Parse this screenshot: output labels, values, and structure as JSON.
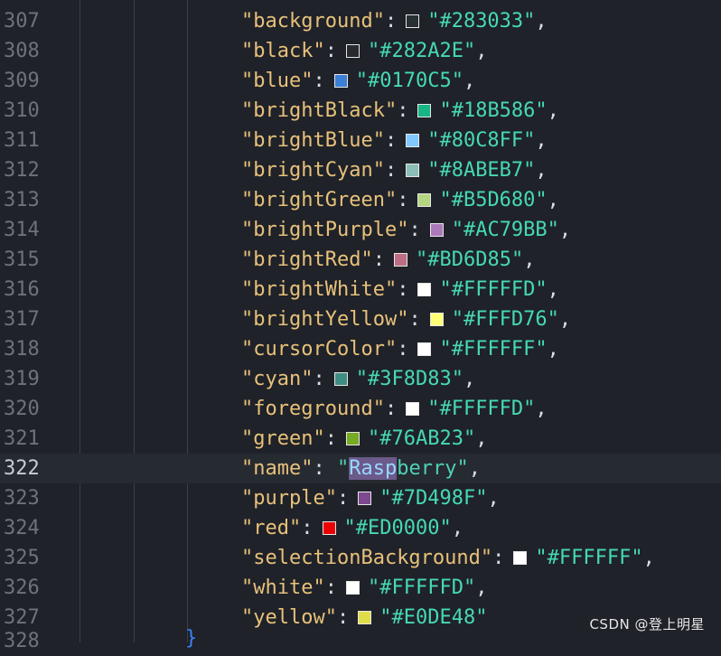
{
  "editor": {
    "lines": [
      {
        "num": "307",
        "key": "background",
        "value": "#283033",
        "swatch": "#283033",
        "kind": "color"
      },
      {
        "num": "308",
        "key": "black",
        "value": "#282A2E",
        "swatch": "#282A2E",
        "kind": "color"
      },
      {
        "num": "309",
        "key": "blue",
        "value": "#0170C5",
        "swatch": "#3b7fd6",
        "kind": "color"
      },
      {
        "num": "310",
        "key": "brightBlack",
        "value": "#18B586",
        "swatch": "#18B586",
        "kind": "color"
      },
      {
        "num": "311",
        "key": "brightBlue",
        "value": "#80C8FF",
        "swatch": "#80C8FF",
        "kind": "color"
      },
      {
        "num": "312",
        "key": "brightCyan",
        "value": "#8ABEB7",
        "swatch": "#8ABEB7",
        "kind": "color"
      },
      {
        "num": "313",
        "key": "brightGreen",
        "value": "#B5D680",
        "swatch": "#B5D680",
        "kind": "color"
      },
      {
        "num": "314",
        "key": "brightPurple",
        "value": "#AC79BB",
        "swatch": "#AC79BB",
        "kind": "color"
      },
      {
        "num": "315",
        "key": "brightRed",
        "value": "#BD6D85",
        "swatch": "#BD6D85",
        "kind": "color"
      },
      {
        "num": "316",
        "key": "brightWhite",
        "value": "#FFFFFD",
        "swatch": "#FFFFFD",
        "kind": "color"
      },
      {
        "num": "317",
        "key": "brightYellow",
        "value": "#FFFD76",
        "swatch": "#FFFD76",
        "kind": "color"
      },
      {
        "num": "318",
        "key": "cursorColor",
        "value": "#FFFFFF",
        "swatch": "#FFFFFF",
        "kind": "color"
      },
      {
        "num": "319",
        "key": "cyan",
        "value": "#3F8D83",
        "swatch": "#3F8D83",
        "kind": "color"
      },
      {
        "num": "320",
        "key": "foreground",
        "value": "#FFFFFD",
        "swatch": "#FFFFFD",
        "kind": "color"
      },
      {
        "num": "321",
        "key": "green",
        "value": "#76AB23",
        "swatch": "#76AB23",
        "kind": "color"
      },
      {
        "num": "322",
        "key": "name",
        "value_hl": "Rasp",
        "value_rest": "berry",
        "kind": "string",
        "current": true
      },
      {
        "num": "323",
        "key": "purple",
        "value": "#7D498F",
        "swatch": "#7D498F",
        "kind": "color"
      },
      {
        "num": "324",
        "key": "red",
        "value": "#ED0000",
        "swatch": "#ED0000",
        "kind": "color"
      },
      {
        "num": "325",
        "key": "selectionBackground",
        "value": "#FFFFFF",
        "swatch": "#FFFFFF",
        "kind": "color"
      },
      {
        "num": "326",
        "key": "white",
        "value": "#FFFFFD",
        "swatch": "#FFFFFD",
        "kind": "color"
      },
      {
        "num": "327",
        "key": "yellow",
        "value": "#E0DE48",
        "swatch": "#E0DE48",
        "kind": "color",
        "last": true
      }
    ],
    "peek_line_number": "328",
    "open_brace": "{",
    "close_brace": "}"
  },
  "watermark": "CSDN @登上明星",
  "colors": {
    "background": "#1f2229",
    "key": "#e8c17a",
    "value": "#46d9b3",
    "line_number": "#6d727c",
    "brace": "#3b82f6"
  }
}
